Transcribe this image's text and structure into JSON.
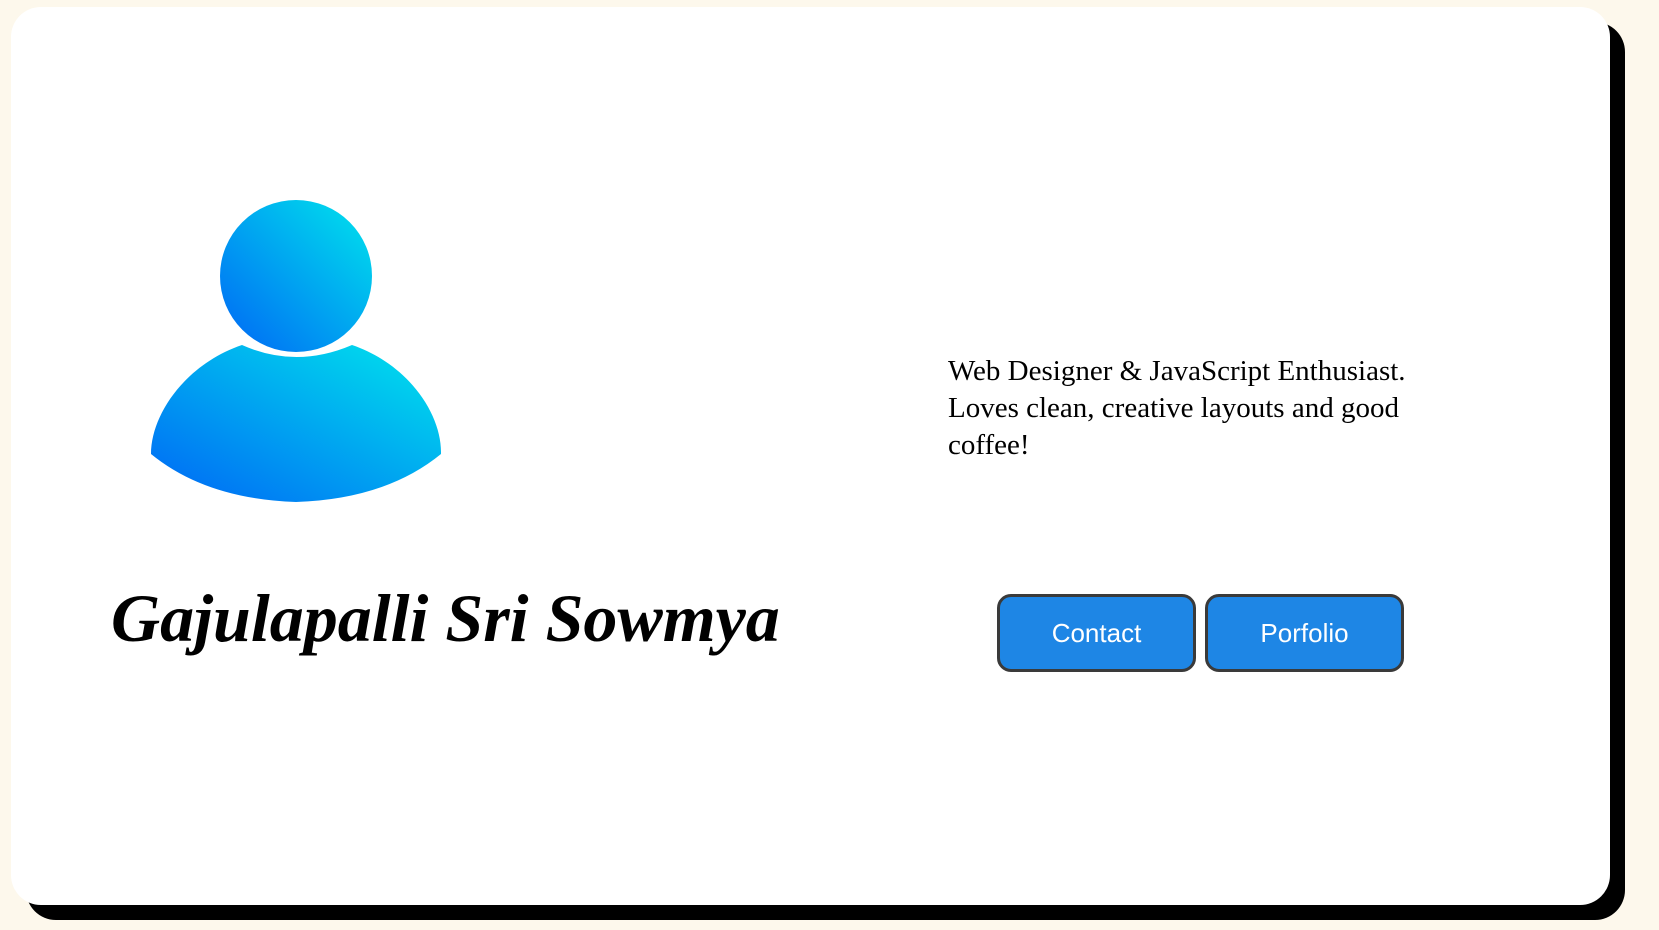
{
  "profile": {
    "name": "Gajulapalli Sri Sowmya",
    "bio": "Web Designer & JavaScript Enthusiast. Loves clean, creative layouts and good coffee!",
    "avatar_icon": "user-icon"
  },
  "actions": {
    "contact_label": "Contact",
    "portfolio_label": "Porfolio"
  },
  "colors": {
    "page_background": "#fdf8ec",
    "card_background": "#ffffff",
    "button_background": "#1e86e5",
    "avatar_gradient_start": "#0066f5",
    "avatar_gradient_end": "#00e5ec"
  }
}
